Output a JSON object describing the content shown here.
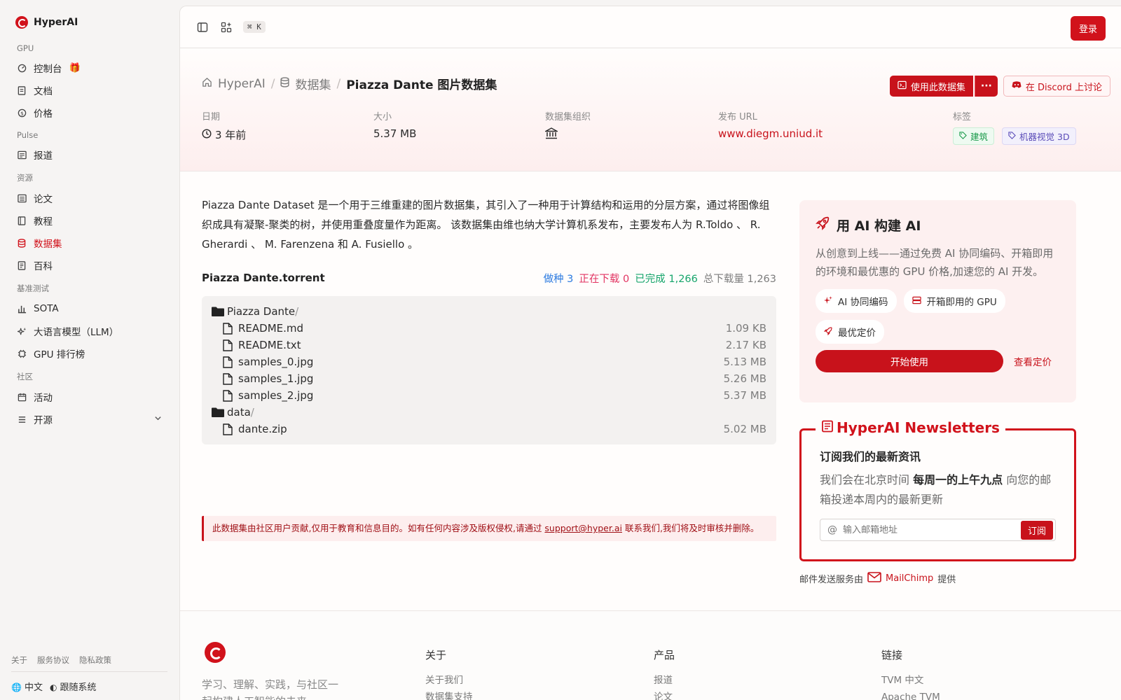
{
  "brand": {
    "name": "HyperAI"
  },
  "sidebar": {
    "groups": [
      {
        "title": "GPU",
        "items": [
          {
            "label": "控制台",
            "icon": "gauge-icon"
          },
          {
            "label": "文档",
            "icon": "book-icon"
          },
          {
            "label": "价格",
            "icon": "dollar-icon"
          }
        ]
      },
      {
        "title": "Pulse",
        "items": [
          {
            "label": "报道",
            "icon": "newspaper-icon"
          }
        ]
      },
      {
        "title": "资源",
        "items": [
          {
            "label": "论文",
            "icon": "paper-icon"
          },
          {
            "label": "教程",
            "icon": "notebook-icon"
          },
          {
            "label": "数据集",
            "icon": "database-icon",
            "active": true
          },
          {
            "label": "百科",
            "icon": "encyclopedia-icon"
          }
        ]
      },
      {
        "title": "基准测试",
        "items": [
          {
            "label": "SOTA",
            "icon": "bar-chart-icon"
          },
          {
            "label": "大语言模型（LLM）",
            "icon": "sparkle-icon"
          },
          {
            "label": "GPU 排行榜",
            "icon": "chip-icon"
          }
        ]
      },
      {
        "title": "社区",
        "items": [
          {
            "label": "活动",
            "icon": "calendar-icon"
          },
          {
            "label": "开源",
            "icon": "list-icon"
          }
        ]
      }
    ],
    "footer_links": [
      "关于",
      "服务协议",
      "隐私政策"
    ],
    "language": "中文",
    "theme": "跟随系统"
  },
  "topbar": {
    "shortcut": "⌘ K",
    "login": "登录"
  },
  "breadcrumb": {
    "home": "HyperAI",
    "section": "数据集",
    "current": "Piazza Dante 图片数据集"
  },
  "actions": {
    "use": "使用此数据集",
    "discord": "在 Discord 上讨论"
  },
  "meta": {
    "date_label": "日期",
    "date_value": "3 年前",
    "size_label": "大小",
    "size_value": "5.37 MB",
    "org_label": "数据集组织",
    "url_label": "发布 URL",
    "url_value": "www.diegm.uniud.it",
    "tags_label": "标签",
    "tags": [
      "建筑",
      "机器视觉 3D"
    ]
  },
  "description": "Piazza Dante Dataset 是一个用于三维重建的图片数据集，其引入了一种用于计算结构和运用的分层方案，通过将图像组织成具有凝聚-聚类的树，并使用重叠度量作为距离。 该数据集由维也纳大学计算机系发布，主要发布人为 R.Toldo 、 R. Gherardi 、 M. Farenzena 和 A. Fusiello 。",
  "torrent": {
    "name": "Piazza Dante.torrent",
    "seeding_label": "做种",
    "seeding": "3",
    "downloading_label": "正在下载",
    "downloading": "0",
    "completed_label": "已完成",
    "completed": "1,266",
    "total_label": "总下载量",
    "total": "1,263"
  },
  "files": [
    {
      "name": "Piazza Dante",
      "type": "folder",
      "size": ""
    },
    {
      "name": "README.md",
      "type": "file",
      "size": "1.09 KB"
    },
    {
      "name": "README.txt",
      "type": "file",
      "size": "2.17 KB"
    },
    {
      "name": "samples_0.jpg",
      "type": "file",
      "size": "5.13 MB"
    },
    {
      "name": "samples_1.jpg",
      "type": "file",
      "size": "5.26 MB"
    },
    {
      "name": "samples_2.jpg",
      "type": "file",
      "size": "5.37 MB"
    },
    {
      "name": "data",
      "type": "folder",
      "size": ""
    },
    {
      "name": "dante.zip",
      "type": "file",
      "size": "5.02 MB"
    }
  ],
  "notice": {
    "before": "此数据集由社区用户贡献,仅用于教育和信息目的。如有任何内容涉及版权侵权,请通过 ",
    "email": "support@hyper.ai",
    "after": " 联系我们,我们将及时审核并删除。"
  },
  "ai_card": {
    "title": "用 AI 构建 AI",
    "desc": "从创意到上线——通过免费 AI 协同编码、开箱即用的环境和最优惠的 GPU 价格,加速您的 AI 开发。",
    "chips": [
      "AI 协同编码",
      "开箱即用的 GPU",
      "最优定价"
    ],
    "start": "开始使用",
    "pricing": "查看定价"
  },
  "newsletter": {
    "title": "HyperAI Newsletters",
    "subtitle": "订阅我们的最新资讯",
    "text_before": "我们会在北京时间 ",
    "text_bold": "每周一的上午九点",
    "text_after": " 向您的邮箱投递本周内的最新更新",
    "placeholder": "输入邮箱地址",
    "button": "订阅",
    "provider_before": "邮件发送服务由",
    "provider": "MailChimp",
    "provider_after": "提供"
  },
  "footer": {
    "tagline": "学习、理解、实践，与社区一起构建人工智能的未来",
    "cols": [
      {
        "title": "关于",
        "links": [
          "关于我们",
          "数据集支持"
        ]
      },
      {
        "title": "产品",
        "links": [
          "报道",
          "论文"
        ]
      },
      {
        "title": "链接",
        "links": [
          "TVM 中文",
          "Apache TVM"
        ]
      }
    ]
  },
  "colors": {
    "accent": "#d1121b",
    "seed": "#2d7be0",
    "downloading": "#e23462",
    "completed": "#16a56b"
  }
}
